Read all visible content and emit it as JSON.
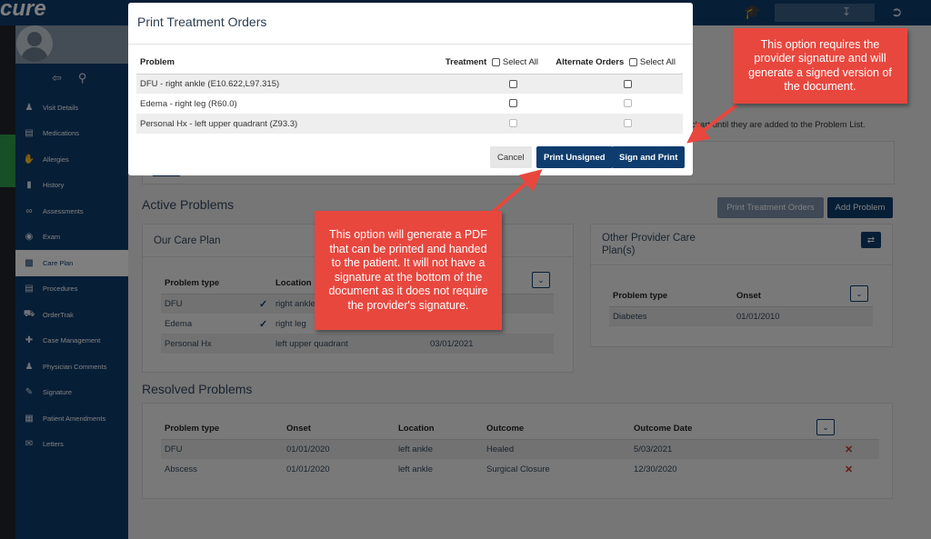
{
  "brand": {
    "name": "cure"
  },
  "sidebar": {
    "items": [
      {
        "label": "Visit Details",
        "icon": "users-icon"
      },
      {
        "label": "Medications",
        "icon": "clipboard-icon"
      },
      {
        "label": "Allergies",
        "icon": "hand-icon"
      },
      {
        "label": "History",
        "icon": "book-icon"
      },
      {
        "label": "Assessments",
        "icon": "glasses-icon"
      },
      {
        "label": "Exam",
        "icon": "eye-icon"
      },
      {
        "label": "Care Plan",
        "icon": "document-icon",
        "active": true
      },
      {
        "label": "Procedures",
        "icon": "procedure-icon"
      },
      {
        "label": "OrderTrak",
        "icon": "truck-icon"
      },
      {
        "label": "Case Management",
        "icon": "medkit-icon"
      },
      {
        "label": "Physician Comments",
        "icon": "person-icon"
      },
      {
        "label": "Signature",
        "icon": "pen-icon"
      },
      {
        "label": "Patient Amendments",
        "icon": "folder-icon"
      },
      {
        "label": "Letters",
        "icon": "envelope-icon"
      }
    ]
  },
  "background": {
    "hint_text": "chart until they are added to the Problem List.",
    "active_problems": {
      "title": "Active Problems",
      "print_button": "Print Treatment Orders",
      "add_button": "Add Problem",
      "our_care_plan": {
        "title": "Our Care Plan",
        "headers": [
          "Problem type",
          "Location",
          ""
        ],
        "rows": [
          {
            "type": "DFU",
            "checked": true,
            "location": "right ankle",
            "onset": ""
          },
          {
            "type": "Edema",
            "checked": true,
            "location": "right leg",
            "onset": ""
          },
          {
            "type": "Personal Hx",
            "checked": false,
            "location": "left upper quadrant",
            "onset": "03/01/2021"
          }
        ]
      },
      "other_provider": {
        "title": "Other Provider Care Plan(s)",
        "headers": [
          "Problem type",
          "Onset"
        ],
        "rows": [
          {
            "type": "Diabetes",
            "onset": "01/01/2010"
          }
        ]
      }
    },
    "resolved_problems": {
      "title": "Resolved Problems",
      "headers": [
        "Problem type",
        "Onset",
        "Location",
        "Outcome",
        "Outcome Date"
      ],
      "rows": [
        {
          "type": "DFU",
          "onset": "01/01/2020",
          "location": "left ankle",
          "outcome": "Healed",
          "date": "5/03/2021"
        },
        {
          "type": "Abscess",
          "onset": "01/01/2020",
          "location": "left ankle",
          "outcome": "Surgical Closure",
          "date": "12/30/2020"
        }
      ]
    }
  },
  "modal": {
    "title": "Print Treatment Orders",
    "headers": {
      "problem": "Problem",
      "treatment": "Treatment",
      "alternate": "Alternate Orders",
      "select_all": "Select All"
    },
    "rows": [
      {
        "problem": "DFU - right ankle (E10.622,L97.315)",
        "treatment_enabled": true,
        "alternate_enabled": true
      },
      {
        "problem": "Edema - right leg (R60.0)",
        "treatment_enabled": true,
        "alternate_enabled": false
      },
      {
        "problem": "Personal Hx - left upper quadrant (Z93.3)",
        "treatment_enabled": false,
        "alternate_enabled": false
      }
    ],
    "buttons": {
      "cancel": "Cancel",
      "print_unsigned": "Print Unsigned",
      "sign_and_print": "Sign and Print"
    }
  },
  "callouts": {
    "sign": "This option requires the provider signature and will generate a signed version of the document.",
    "unsigned": "This option will generate a PDF that can be printed and handed to the patient. It will not have a signature at the bottom of the document as it does not require the provider's signature."
  },
  "colors": {
    "navy": "#0e3c6e",
    "callout_red": "#e8473e",
    "delete_red": "#c0392b"
  }
}
